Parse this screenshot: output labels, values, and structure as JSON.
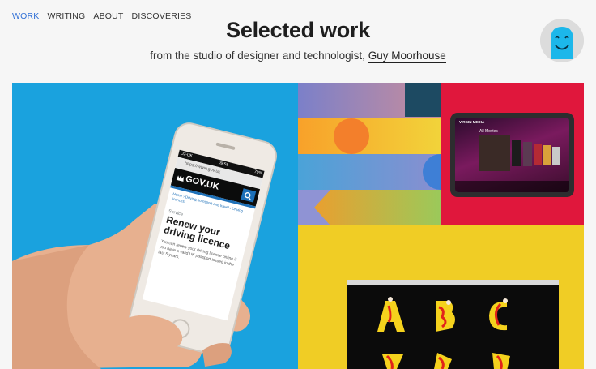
{
  "nav": {
    "items": [
      {
        "label": "WORK",
        "active": true
      },
      {
        "label": "WRITING",
        "active": false
      },
      {
        "label": "ABOUT",
        "active": false
      },
      {
        "label": "DISCOVERIES",
        "active": false
      }
    ]
  },
  "header": {
    "title": "Selected work",
    "subtitle_prefix": "from the studio of designer and technologist,",
    "subtitle_link": "Guy Moorhouse"
  },
  "phone_screen": {
    "status_carrier": "O2-UK",
    "status_time": "09:58",
    "status_battery": "79%",
    "url": "https://www.gov.uk",
    "brand": "GOV.UK",
    "breadcrumb": "Home › Driving, transport and travel › Driving licences",
    "section_label": "Service",
    "heading": "Renew your driving licence",
    "body": "You can renew your driving licence online if you have a valid UK passport issued in the last 5 years."
  },
  "tv_screen": {
    "brand": "VIRGIN MEDIA",
    "heading": "All Movies"
  },
  "colors": {
    "nav_active": "#2f6fd6",
    "phone_bg": "#1aa2de",
    "virgin_bg": "#e0173c",
    "type_bg": "#f0cd25",
    "govuk_black": "#0b0c0c"
  },
  "icons": [
    "smiley-avatar-icon",
    "search-icon",
    "crown-icon"
  ]
}
